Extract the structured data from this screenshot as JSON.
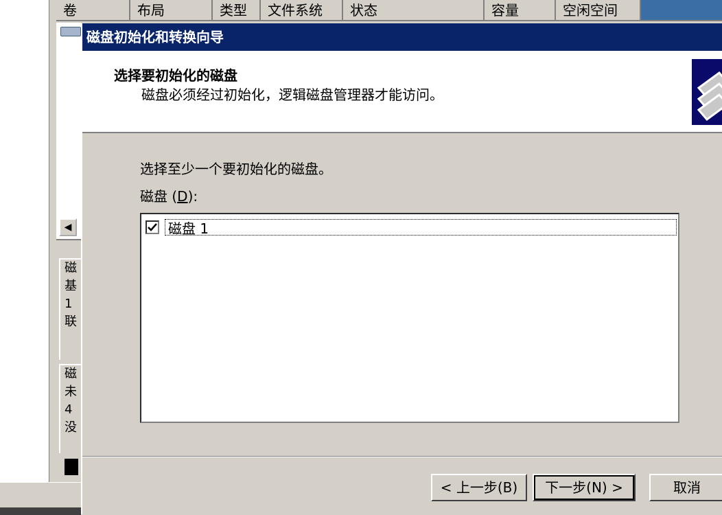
{
  "background_window": {
    "columns": [
      "卷",
      "布局",
      "类型",
      "文件系统",
      "状态",
      "容量",
      "空闲空间",
      ""
    ],
    "scroll_left_symbol": "◀",
    "disk_panels": [
      {
        "lines": [
          "磁",
          "基",
          "1",
          "联"
        ]
      },
      {
        "lines": [
          "磁",
          "未",
          "4",
          "没"
        ]
      }
    ]
  },
  "dialog": {
    "title": "磁盘初始化和转换向导",
    "header": {
      "title": "选择要初始化的磁盘",
      "subtitle": "磁盘必须经过初始化，逻辑磁盘管理器才能访问。"
    },
    "prompt": "选择至少一个要初始化的磁盘。",
    "disk_label": "磁盘",
    "disk_label_accel": "D",
    "disk_list": [
      {
        "label": "磁盘 1",
        "checked": true
      }
    ],
    "buttons": {
      "back": "< 上一步(B)",
      "next": "下一步(N) >",
      "cancel": "取消"
    }
  },
  "colors": {
    "titlebar": "#0a246a",
    "face": "#d4d0c8",
    "header_blue": "#3a6ea5"
  }
}
